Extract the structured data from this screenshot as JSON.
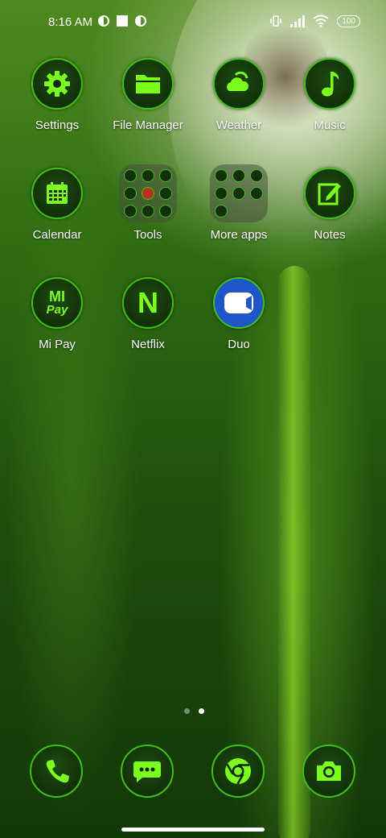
{
  "status": {
    "time": "8:16 AM",
    "battery": "100"
  },
  "apps": {
    "settings": "Settings",
    "file_manager": "File Manager",
    "weather": "Weather",
    "music": "Music",
    "calendar": "Calendar",
    "tools": "Tools",
    "more_apps": "More apps",
    "notes": "Notes",
    "mi_pay": "Mi Pay",
    "netflix": "Netflix",
    "duo": "Duo"
  },
  "icon_text": {
    "mi": "MI",
    "pay": "Pay",
    "netflix_letter": "N"
  },
  "page_indicator": {
    "pages": 2,
    "current": 2
  },
  "dock": [
    {
      "name": "phone-icon"
    },
    {
      "name": "messages-icon"
    },
    {
      "name": "chrome-icon"
    },
    {
      "name": "camera-icon"
    }
  ],
  "colors": {
    "accent": "#3fbf14",
    "icon_glyph": "#7dff1e",
    "icon_bg": "#0d2606"
  }
}
